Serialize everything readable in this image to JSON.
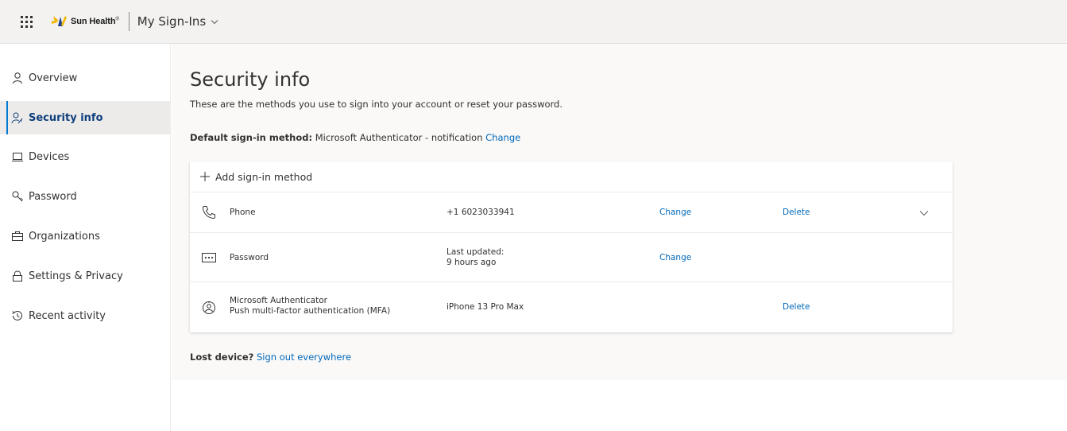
{
  "header": {
    "brand_name": "Sun Health",
    "brand_mark": "®",
    "app_title": "My Sign-Ins"
  },
  "sidebar": {
    "items": [
      {
        "label": "Overview",
        "icon": "person-icon"
      },
      {
        "label": "Security info",
        "icon": "security-key-icon",
        "active": true
      },
      {
        "label": "Devices",
        "icon": "laptop-icon"
      },
      {
        "label": "Password",
        "icon": "key-icon"
      },
      {
        "label": "Organizations",
        "icon": "briefcase-icon"
      },
      {
        "label": "Settings & Privacy",
        "icon": "lock-icon"
      },
      {
        "label": "Recent activity",
        "icon": "history-icon"
      }
    ]
  },
  "main": {
    "title": "Security info",
    "description": "These are the methods you use to sign into your account or reset your password.",
    "default_method": {
      "label": "Default sign-in method:",
      "value": "Microsoft Authenticator - notification",
      "change_link": "Change"
    },
    "add_method_label": "Add sign-in method",
    "methods": [
      {
        "name": "Phone",
        "detail": "+1 6023033941",
        "change": "Change",
        "delete": "Delete",
        "icon": "phone-icon"
      },
      {
        "name": "Password",
        "detail_line1": "Last updated:",
        "detail_line2": "9 hours ago",
        "change": "Change",
        "icon": "password-dots-icon"
      },
      {
        "name_line1": "Microsoft Authenticator",
        "name_line2": "Push multi-factor authentication (MFA)",
        "detail": "iPhone 13 Pro Max",
        "delete": "Delete",
        "icon": "authenticator-icon"
      }
    ],
    "lost_device": {
      "label": "Lost device?",
      "link": "Sign out everywhere"
    }
  },
  "colors": {
    "accent": "#0078d4",
    "link": "#0067b8",
    "topbar_bg": "#f3f2f1",
    "active_nav_bg": "#edebe9",
    "brand_yellow": "#f2b705",
    "brand_blue": "#1f3f8a"
  }
}
